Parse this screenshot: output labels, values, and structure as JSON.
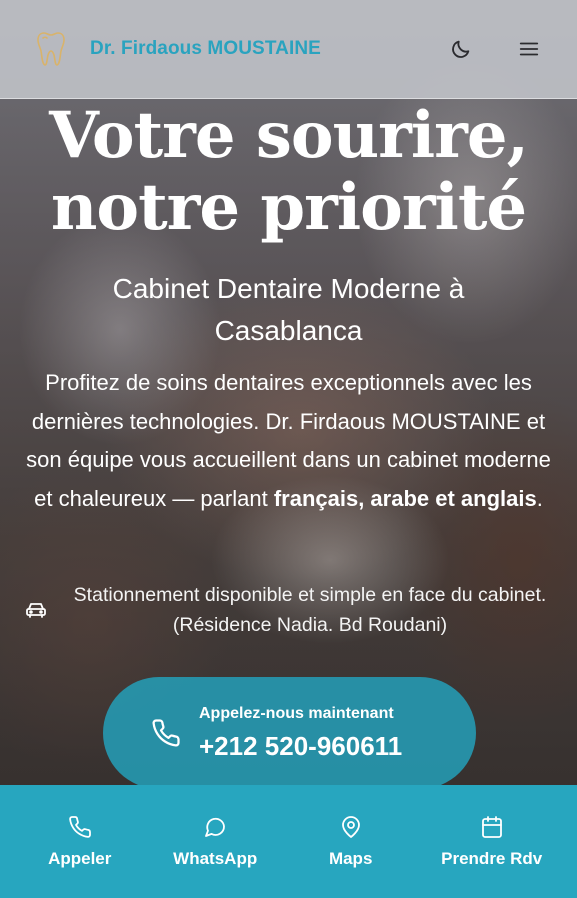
{
  "header": {
    "brand": "Dr. Firdaous MOUSTAINE",
    "logo_icon": "tooth-icon",
    "theme_icon": "moon-icon",
    "menu_icon": "hamburger-menu-icon",
    "brand_color": "#2aa3bf"
  },
  "hero": {
    "title_line1": "Votre sourire,",
    "title_line2": "notre priorité",
    "subtitle": "Cabinet Dentaire Moderne à Casablanca",
    "text_before": "Profitez de soins dentaires exceptionnels avec les dernières technologies. Dr. Firdaous MOUSTAINE et son équipe vous accueillent dans un cabinet moderne et chaleureux — parlant ",
    "text_bold": "français, arabe et anglais",
    "text_after": ".",
    "parking_icon": "car-icon",
    "parking_text": "Stationnement disponible et simple en face du cabinet. (Résidence Nadia. Bd Roudani)"
  },
  "call_cta": {
    "icon": "phone-icon",
    "label": "Appelez-nous maintenant",
    "number": "+212 520-960611",
    "color": "#249cb5"
  },
  "bottom_nav": {
    "color": "#27a6bf",
    "items": [
      {
        "label": "Appeler",
        "icon": "phone-icon"
      },
      {
        "label": "WhatsApp",
        "icon": "chat-bubble-icon"
      },
      {
        "label": "Maps",
        "icon": "map-pin-icon"
      },
      {
        "label": "Prendre Rdv",
        "icon": "calendar-icon"
      }
    ]
  }
}
